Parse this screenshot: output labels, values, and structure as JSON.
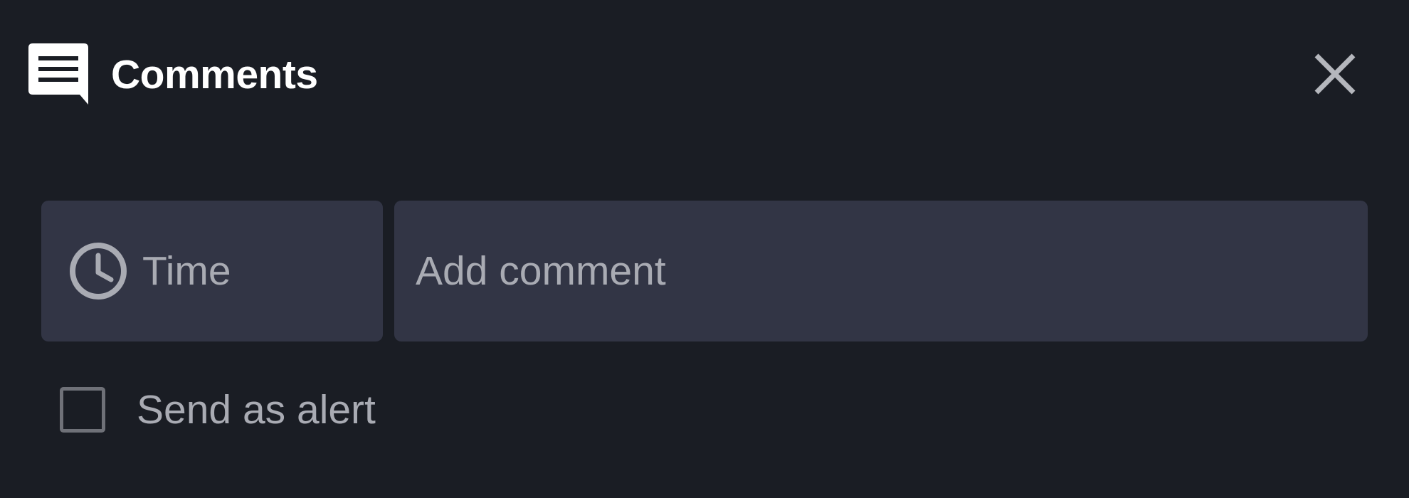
{
  "header": {
    "title": "Comments",
    "icon": "comment-icon",
    "close_icon": "close-icon"
  },
  "composer": {
    "time_label": "Time",
    "time_icon": "clock-icon",
    "comment_placeholder": "Add comment",
    "comment_value": ""
  },
  "alert": {
    "label": "Send as alert",
    "checked": false
  },
  "colors": {
    "background": "#1a1d24",
    "field_background": "#323545",
    "text_primary": "#ffffff",
    "text_secondary": "#a9abb3",
    "checkbox_border": "#6f7178"
  }
}
